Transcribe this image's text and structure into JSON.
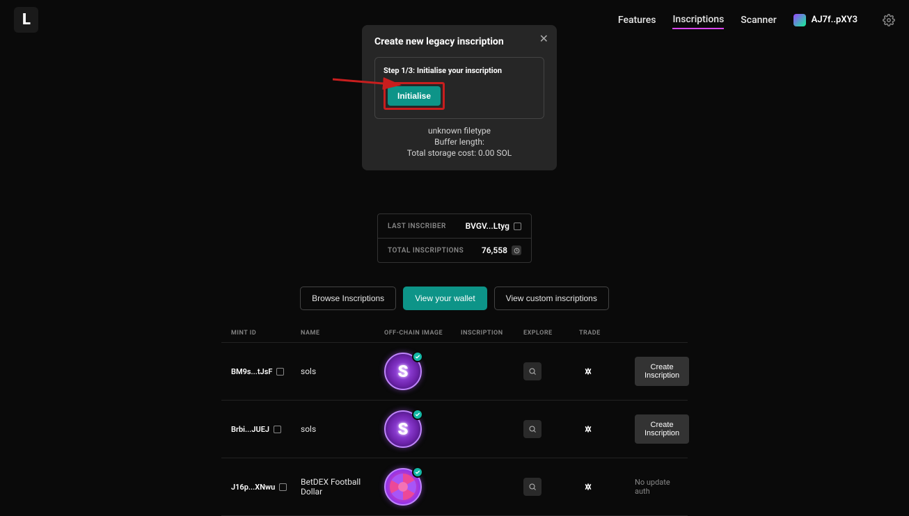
{
  "header": {
    "logo": "L",
    "nav": {
      "features": "Features",
      "inscriptions": "Inscriptions",
      "scanner": "Scanner"
    },
    "wallet_addr": "AJ7f..pXY3"
  },
  "modal": {
    "title": "Create new legacy inscription",
    "step_label": "Step 1/3: Initialise your inscription",
    "init_btn": "Initialise",
    "filetype": "unknown filetype",
    "buffer": "Buffer length:",
    "cost": "Total storage cost: 0.00 SOL"
  },
  "stats": {
    "last_inscriber_label": "LAST INSCRIBER",
    "last_inscriber_val": "BVGV...Ltyg",
    "total_label": "TOTAL INSCRIPTIONS",
    "total_val": "76,558"
  },
  "tabs": {
    "browse": "Browse Inscriptions",
    "wallet": "View your wallet",
    "custom": "View custom inscriptions"
  },
  "columns": {
    "mint": "MINT ID",
    "name": "NAME",
    "image": "OFF-CHAIN IMAGE",
    "insc": "INSCRIPTION",
    "explore": "EXPLORE",
    "trade": "TRADE"
  },
  "rows": [
    {
      "mint": "BM9s...tJsF",
      "name": "sols",
      "action": "Create Inscription",
      "img": "coin-s"
    },
    {
      "mint": "Brbi...JUEJ",
      "name": "sols",
      "action": "Create Inscription",
      "img": "coin-s"
    },
    {
      "mint": "J16p...XNwu",
      "name": "BetDEX Football Dollar",
      "action": "No update auth",
      "img": "coin-ball"
    }
  ]
}
